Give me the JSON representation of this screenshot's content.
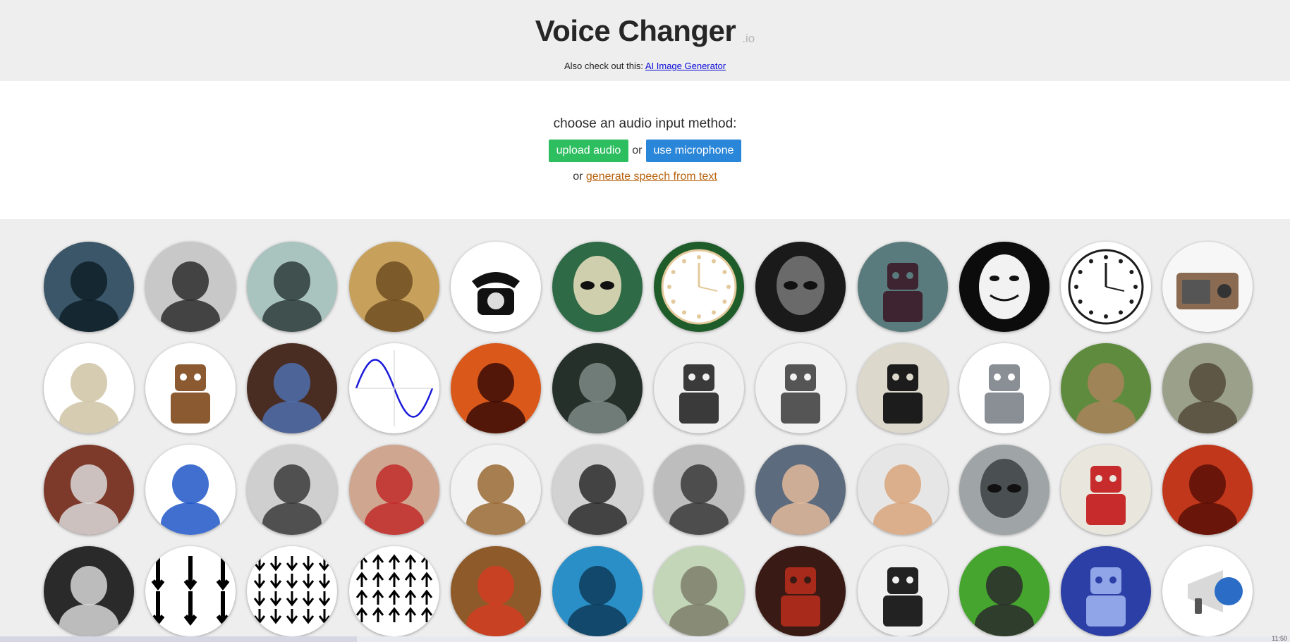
{
  "header": {
    "title": "Voice Changer",
    "title_suffix": ".io",
    "also_text": "Also check out this:",
    "also_link": "AI Image Generator"
  },
  "input": {
    "prompt": "choose an audio input method:",
    "upload_label": "upload audio",
    "or1": "or",
    "mic_label": "use microphone",
    "or2": "or",
    "tts_link": "generate speech from text"
  },
  "bottom": {
    "clock": "11:50"
  },
  "voices": [
    {
      "icon": "monster-roar-icon",
      "bg": "#3b5668",
      "fg": "#0f1e28"
    },
    {
      "icon": "gramophone-horn-icon",
      "bg": "#c8c8c8",
      "fg": "#2c2c2c"
    },
    {
      "icon": "ghost-hand-icon",
      "bg": "#a9c3bf",
      "fg": "#2d3c3a"
    },
    {
      "icon": "cathedral-icon",
      "bg": "#c7a15b",
      "fg": "#6e4d22"
    },
    {
      "icon": "rotary-telephone-icon",
      "bg": "#ffffff",
      "fg": "#111111"
    },
    {
      "icon": "grey-alien-icon",
      "bg": "#2e6a45",
      "fg": "#cfcfae"
    },
    {
      "icon": "melting-clock-icon",
      "bg": "#1e5c2a",
      "fg": "#e3c99b"
    },
    {
      "icon": "dark-alien-icon",
      "bg": "#1a1a1a",
      "fg": "#6a6a6a"
    },
    {
      "icon": "cyborg-icon",
      "bg": "#5a7b7d",
      "fg": "#3d2430"
    },
    {
      "icon": "guy-fawkes-mask-icon",
      "bg": "#0c0c0c",
      "fg": "#f2f2f2"
    },
    {
      "icon": "backwards-clock-icon",
      "bg": "#ffffff",
      "fg": "#1c1c1c"
    },
    {
      "icon": "retro-radio-icon",
      "bg": "#f7f7f7",
      "fg": "#8a6b52"
    },
    {
      "icon": "cymbal-icon",
      "bg": "#ffffff",
      "fg": "#cfc3a4"
    },
    {
      "icon": "dalek-icon",
      "bg": "#ffffff",
      "fg": "#8b5a30"
    },
    {
      "icon": "guitar-pedal-icon",
      "bg": "#4a2d22",
      "fg": "#4d6fae"
    },
    {
      "icon": "sine-wave-icon",
      "bg": "#ffffff",
      "fg": "#1b1bd9"
    },
    {
      "icon": "balrog-fire-icon",
      "bg": "#d9581a",
      "fg": "#3a0c06"
    },
    {
      "icon": "cave-icon",
      "bg": "#26302b",
      "fg": "#7d8a86"
    },
    {
      "icon": "white-robot-icon",
      "bg": "#f0f0f0",
      "fg": "#3a3a3a"
    },
    {
      "icon": "tall-white-robot-icon",
      "bg": "#f2f2f2",
      "fg": "#555555"
    },
    {
      "icon": "tin-toy-robot-icon",
      "bg": "#dcd8cc",
      "fg": "#1c1c1c"
    },
    {
      "icon": "lego-robot-icon",
      "bg": "#ffffff",
      "fg": "#8a8f96"
    },
    {
      "icon": "snail-icon",
      "bg": "#5f8b3e",
      "fg": "#a9825a"
    },
    {
      "icon": "tortoise-icon",
      "bg": "#9aa08a",
      "fg": "#544a38"
    },
    {
      "icon": "sprinter-icon",
      "bg": "#7d3a2a",
      "fg": "#d9d9d9"
    },
    {
      "icon": "hedgehog-icon",
      "bg": "#ffffff",
      "fg": "#1e56c8"
    },
    {
      "icon": "radio-operator-icon",
      "bg": "#cfcfcf",
      "fg": "#3a3a3a"
    },
    {
      "icon": "playing-cards-icon",
      "bg": "#cfa690",
      "fg": "#c12a2a"
    },
    {
      "icon": "wooden-speaker-icon",
      "bg": "#f2f2f2",
      "fg": "#9a6a34"
    },
    {
      "icon": "old-microphone-man-icon",
      "bg": "#d2d2d2",
      "fg": "#2a2a2a"
    },
    {
      "icon": "dark-knight-icon",
      "bg": "#bdbdbd",
      "fg": "#3a3a3a"
    },
    {
      "icon": "ushanka-officer-icon",
      "bg": "#5c6b7d",
      "fg": "#e0b89a"
    },
    {
      "icon": "wtf-meme-icon",
      "bg": "#e6e6e6",
      "fg": "#d8a47a"
    },
    {
      "icon": "grey-alien-robot-icon",
      "bg": "#9fa4a6",
      "fg": "#4a4f52"
    },
    {
      "icon": "kirobo-robot-icon",
      "bg": "#e8e6dd",
      "fg": "#c82b2b"
    },
    {
      "icon": "red-demon-icon",
      "bg": "#c1371b",
      "fg": "#5a0f06"
    },
    {
      "icon": "astronaut-icon",
      "bg": "#2a2a2a",
      "fg": "#d6d6d6"
    },
    {
      "icon": "big-down-arrows-icon",
      "bg": "#ffffff",
      "fg": "#000000"
    },
    {
      "icon": "many-down-arrows-icon",
      "bg": "#ffffff",
      "fg": "#000000"
    },
    {
      "icon": "many-up-arrows-icon",
      "bg": "#ffffff",
      "fg": "#000000"
    },
    {
      "icon": "chipmunk-icon",
      "bg": "#8f5a2a",
      "fg": "#d33d22"
    },
    {
      "icon": "scuba-diver-icon",
      "bg": "#2a8fc6",
      "fg": "#0e3c5a"
    },
    {
      "icon": "retro-computer-icon",
      "bg": "#c3d6b8",
      "fg": "#7e7e6a"
    },
    {
      "icon": "red-robot-icon",
      "bg": "#3a1a14",
      "fg": "#a82a1a"
    },
    {
      "icon": "robot-snake-icon",
      "bg": "#f0f0f0",
      "fg": "#222222"
    },
    {
      "icon": "mosquito-icon",
      "bg": "#45a52e",
      "fg": "#2b2b2b"
    },
    {
      "icon": "blue-transformer-icon",
      "bg": "#2b3fa6",
      "fg": "#90a4e8"
    },
    {
      "icon": "megaphone-icon",
      "bg": "#ffffff",
      "fg": "#2a6cc6"
    }
  ]
}
